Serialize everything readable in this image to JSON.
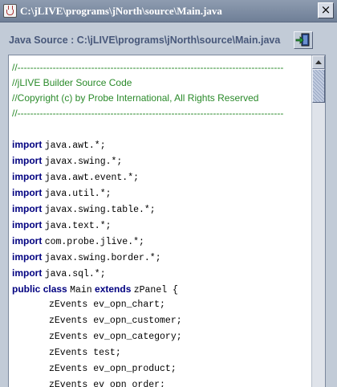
{
  "window": {
    "title": "C:\\jLIVE\\programs\\jNorth\\source\\Main.java",
    "close_glyph": "×"
  },
  "header": {
    "label": "Java Source : C:\\jLIVE\\programs\\jNorth\\source\\Main.java",
    "exit_icon": "exit-door-icon"
  },
  "code": {
    "comment_rule": "//-----------------------------------------------------------------------------------",
    "comment_title": "//jLIVE Builder Source Code",
    "comment_copyright": "//Copyright (c) by Probe International, All Rights Reserved",
    "import_keyword": "import",
    "imports": [
      "java.awt.*;",
      "javax.swing.*;",
      "java.awt.event.*;",
      "java.util.*;",
      "javax.swing.table.*;",
      "java.text.*;",
      "com.probe.jlive.*;",
      "javax.swing.border.*;",
      "java.sql.*;"
    ],
    "class_decl": {
      "kw_public": "public",
      "kw_class": "class",
      "name": "Main",
      "kw_extends": "extends",
      "parent": "zPanel {"
    },
    "fields": [
      "zEvents ev_opn_chart;",
      "zEvents ev_opn_customer;",
      "zEvents ev_opn_category;",
      "zEvents test;",
      "zEvents ev_opn_product;",
      "zEvents ev_opn_order;"
    ]
  },
  "colors": {
    "comment": "#2a8a2a",
    "keyword": "#000080",
    "header_text": "#48587a",
    "window_bg": "#c2cbd7"
  }
}
